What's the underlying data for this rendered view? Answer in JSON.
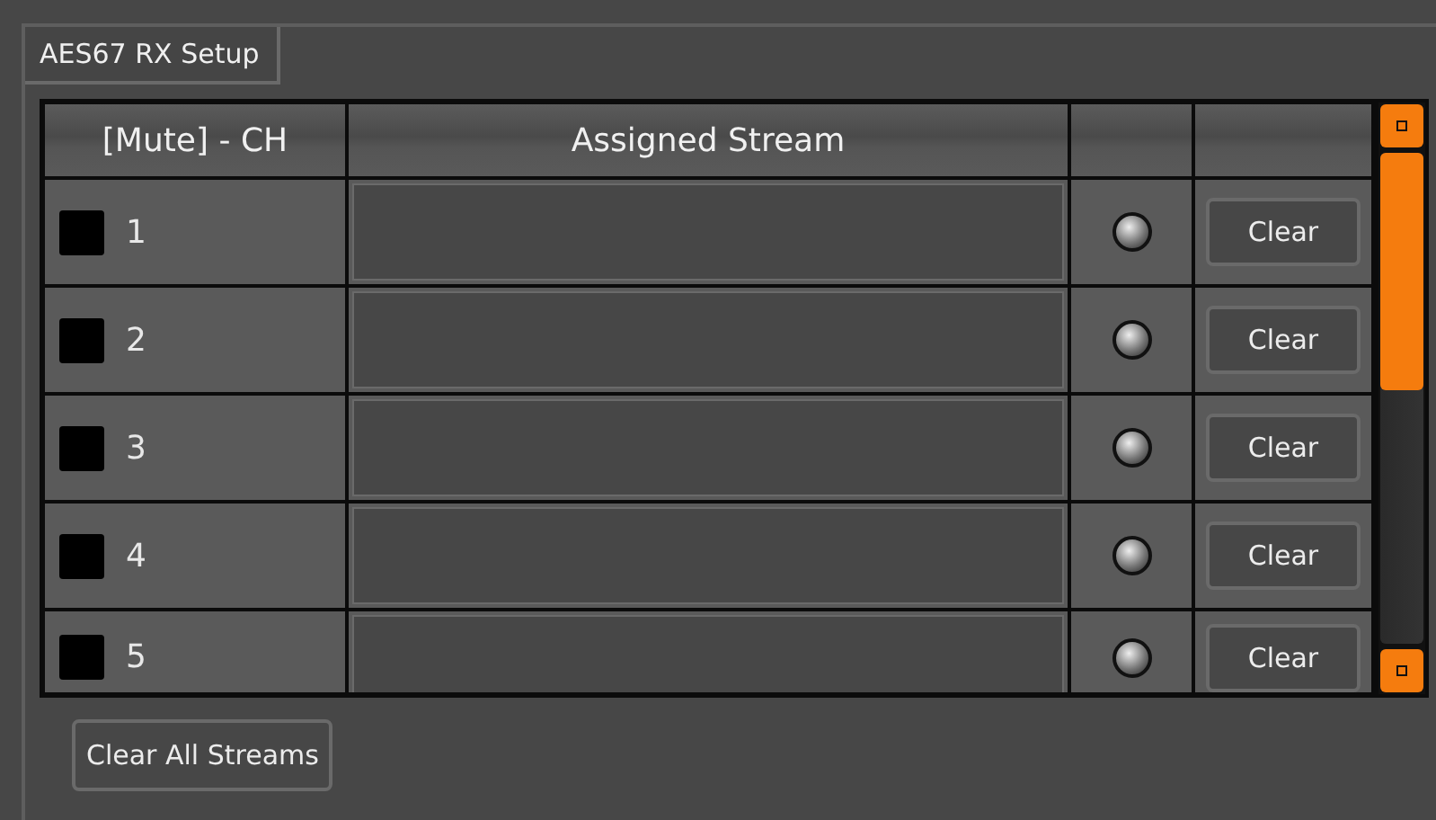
{
  "tab": {
    "label": "AES67 RX Setup"
  },
  "table": {
    "columns": [
      "[Mute] - CH",
      "Assigned Stream"
    ],
    "rows": [
      {
        "channel": "1",
        "muted": false,
        "button": "Clear"
      },
      {
        "channel": "2",
        "muted": false,
        "button": "Clear"
      },
      {
        "channel": "3",
        "muted": false,
        "button": "Clear"
      },
      {
        "channel": "4",
        "muted": false,
        "button": "Clear"
      },
      {
        "channel": "5",
        "muted": false,
        "button": "Clear"
      }
    ]
  },
  "footer_button": "Clear All Streams"
}
